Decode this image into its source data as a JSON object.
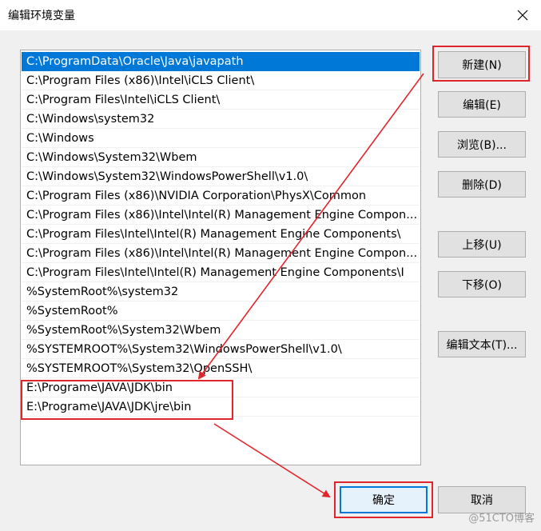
{
  "window": {
    "title": "编辑环境变量"
  },
  "paths": [
    "C:\\ProgramData\\Oracle\\Java\\javapath",
    "C:\\Program Files (x86)\\Intel\\iCLS Client\\",
    "C:\\Program Files\\Intel\\iCLS Client\\",
    "C:\\Windows\\system32",
    "C:\\Windows",
    "C:\\Windows\\System32\\Wbem",
    "C:\\Windows\\System32\\WindowsPowerShell\\v1.0\\",
    "C:\\Program Files (x86)\\NVIDIA Corporation\\PhysX\\Common",
    "C:\\Program Files (x86)\\Intel\\Intel(R) Management Engine Compon...",
    "C:\\Program Files\\Intel\\Intel(R) Management Engine Components\\",
    "C:\\Program Files (x86)\\Intel\\Intel(R) Management Engine Compon...",
    "C:\\Program Files\\Intel\\Intel(R) Management Engine Components\\I",
    "%SystemRoot%\\system32",
    "%SystemRoot%",
    "%SystemRoot%\\System32\\Wbem",
    "%SYSTEMROOT%\\System32\\WindowsPowerShell\\v1.0\\",
    "%SYSTEMROOT%\\System32\\OpenSSH\\",
    "E:\\Programe\\JAVA\\JDK\\bin",
    "E:\\Programe\\JAVA\\JDK\\jre\\bin"
  ],
  "buttons": {
    "new": "新建(N)",
    "edit": "编辑(E)",
    "browse": "浏览(B)...",
    "delete": "删除(D)",
    "move_up": "上移(U)",
    "move_down": "下移(O)",
    "edit_text": "编辑文本(T)...",
    "ok": "确定",
    "cancel": "取消"
  },
  "watermark": "@51CTO博客",
  "colors": {
    "selection": "#0078d7",
    "annotation": "#e0252c"
  }
}
